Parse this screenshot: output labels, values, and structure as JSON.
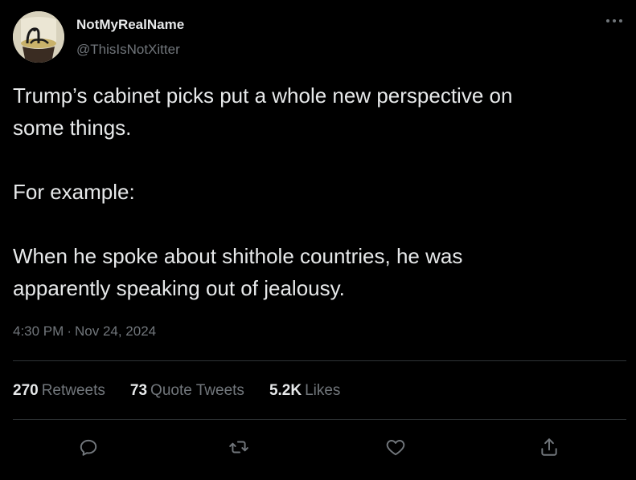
{
  "user": {
    "display_name": "NotMyRealName",
    "handle": "@ThisIsNotXitter"
  },
  "tweet": {
    "lines": [
      "Trump’s cabinet picks put a whole new perspective on",
      "some things.",
      "",
      "For example:",
      "",
      "When he spoke about shithole countries, he was",
      "apparently speaking out of jealousy."
    ],
    "time": "4:30 PM",
    "separator": "·",
    "date": "Nov 24, 2024"
  },
  "stats": {
    "retweets": {
      "count": "270",
      "label": "Retweets"
    },
    "quotes": {
      "count": "73",
      "label": "Quote Tweets"
    },
    "likes": {
      "count": "5.2K",
      "label": "Likes"
    }
  },
  "icons": {
    "more": "more-horizontal-icon",
    "reply": "reply-icon",
    "retweet": "retweet-icon",
    "like": "heart-icon",
    "share": "share-icon"
  },
  "colors": {
    "background": "#000000",
    "primary_text": "#e7e9ea",
    "secondary_text": "#71767b",
    "divider": "#2f3336"
  }
}
